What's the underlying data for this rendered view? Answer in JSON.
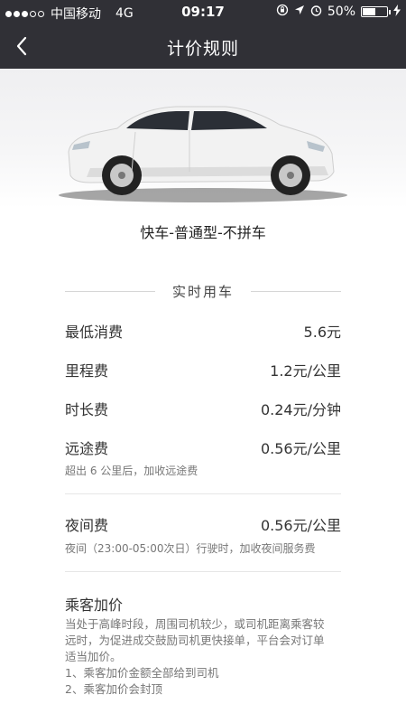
{
  "status_bar": {
    "carrier": "中国移动",
    "network": "4G",
    "time": "09:17",
    "battery_percent": "50%",
    "signal_bars_filled": 3,
    "signal_bars_total": 5
  },
  "nav": {
    "title": "计价规则",
    "back_icon": "chevron-left-icon"
  },
  "car": {
    "type_label": "快车-普通型-不拼车",
    "body_color": "#f2f2f2"
  },
  "section": {
    "title": "实时用车"
  },
  "fees": [
    {
      "name": "最低消费",
      "value": "5.6元"
    },
    {
      "name": "里程费",
      "value": "1.2元/公里"
    },
    {
      "name": "时长费",
      "value": "0.24元/分钟"
    },
    {
      "name": "远途费",
      "value": "0.56元/公里",
      "note": "超出 6 公里后，加收远途费"
    },
    {
      "name": "夜间费",
      "value": "0.56元/公里",
      "note": "夜间（23:00-05:00次日）行驶时，加收夜间服务费"
    }
  ],
  "surge": {
    "title": "乘客加价",
    "lines": [
      "当处于高峰时段，周围司机较少，或司机距离乘客较",
      "远时，为促进成交鼓励司机更快接单，平台会对订单",
      "适当加价。",
      "1、乘客加价金额全部给到司机",
      "2、乘客加价会封顶"
    ]
  },
  "colors": {
    "header_bg": "#303036",
    "page_bg": "#ffffff",
    "text_primary": "#333333",
    "text_secondary": "#777777"
  }
}
